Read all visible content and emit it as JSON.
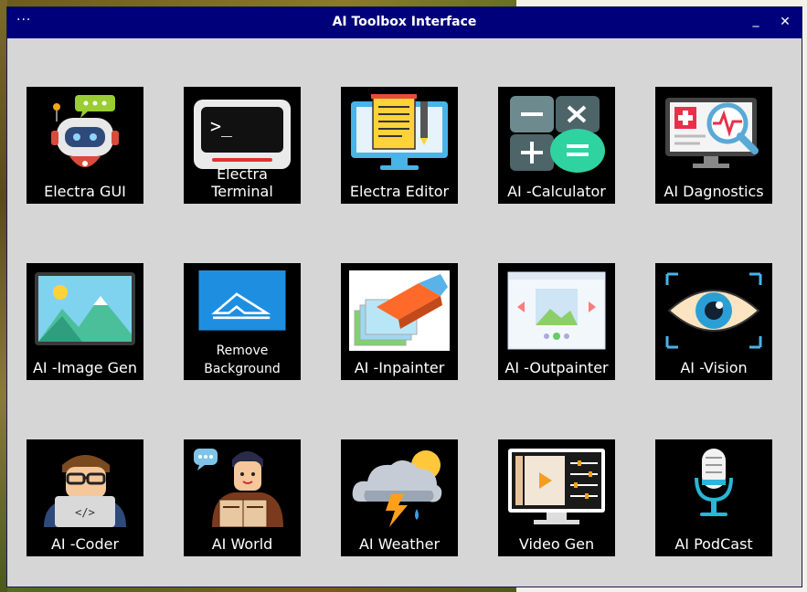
{
  "window": {
    "title": "AI Toolbox Interface",
    "menu_glyph": "···",
    "minimize_glyph": "_",
    "close_glyph": "✕"
  },
  "tools": [
    {
      "label": "Electra GUI",
      "icon": "robot-chat-icon"
    },
    {
      "label": "Electra Terminal",
      "icon": "terminal-icon"
    },
    {
      "label": "Electra Editor",
      "icon": "editor-icon"
    },
    {
      "label": "AI -Calculator",
      "icon": "calculator-icon"
    },
    {
      "label": "AI Dagnostics",
      "icon": "diagnostics-icon"
    },
    {
      "label": "AI -Image Gen",
      "icon": "image-gen-icon"
    },
    {
      "label": "Remove Background",
      "icon": "eraser-background-icon"
    },
    {
      "label": "AI -Inpainter",
      "icon": "inpainter-icon"
    },
    {
      "label": "AI -Outpainter",
      "icon": "outpainter-icon"
    },
    {
      "label": "AI -Vision",
      "icon": "eye-vision-icon"
    },
    {
      "label": "AI -Coder",
      "icon": "coder-icon"
    },
    {
      "label": "AI World",
      "icon": "reader-world-icon"
    },
    {
      "label": "AI Weather",
      "icon": "weather-storm-icon"
    },
    {
      "label": "Video Gen",
      "icon": "video-editor-icon"
    },
    {
      "label": "AI PodCast",
      "icon": "microphone-icon"
    }
  ],
  "remove_background_lines": [
    "Remove",
    "Background"
  ],
  "colors": {
    "titlebar": "#00007a",
    "window_bg": "#d6d6d6",
    "tile_bg": "#000000",
    "label": "#ffffff"
  }
}
